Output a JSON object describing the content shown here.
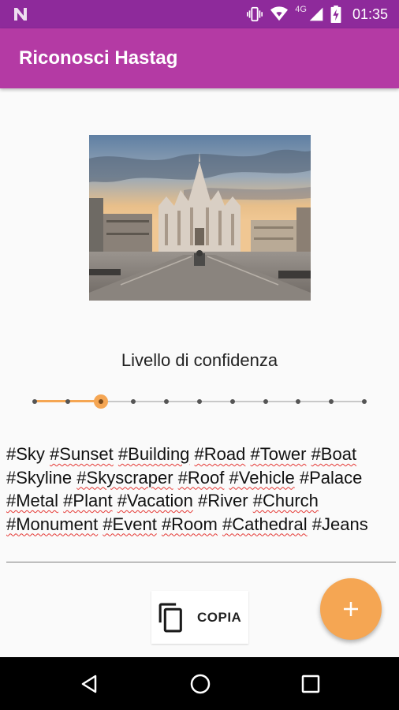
{
  "status_bar": {
    "time": "01:35",
    "network": "4G",
    "icons": [
      "n-notification-icon",
      "vibrate-icon",
      "wifi-icon",
      "signal-icon",
      "battery-charging-icon"
    ]
  },
  "app_bar": {
    "title": "Riconosci Hastag",
    "color": "#b43aa4"
  },
  "image": {
    "icon": "photo-cathedral-image"
  },
  "confidence": {
    "label": "Livello di confidenza",
    "level": 2,
    "steps": 11,
    "accent": "#f5a653"
  },
  "tags": [
    {
      "text": "#Sky",
      "flagged": false
    },
    {
      "text": "#Sunset",
      "flagged": true
    },
    {
      "text": "#Building",
      "flagged": true
    },
    {
      "text": "#Road",
      "flagged": true
    },
    {
      "text": "#Tower",
      "flagged": true
    },
    {
      "text": "#Boat",
      "flagged": true
    },
    {
      "text": "#Skyline",
      "flagged": false
    },
    {
      "text": "#Skyscraper",
      "flagged": true
    },
    {
      "text": "#Roof",
      "flagged": true
    },
    {
      "text": "#Vehicle",
      "flagged": true
    },
    {
      "text": "#Palace",
      "flagged": false
    },
    {
      "text": "#Metal",
      "flagged": true
    },
    {
      "text": "#Plant",
      "flagged": true
    },
    {
      "text": "#Vacation",
      "flagged": true
    },
    {
      "text": "#River",
      "flagged": false
    },
    {
      "text": "#Church",
      "flagged": true
    },
    {
      "text": "#Monument",
      "flagged": true
    },
    {
      "text": "#Event",
      "flagged": true
    },
    {
      "text": "#Room",
      "flagged": true
    },
    {
      "text": "#Cathedral",
      "flagged": true
    },
    {
      "text": "#Jeans",
      "flagged": false
    }
  ],
  "copy_button": {
    "label": "COPIA",
    "icon": "copy-icon"
  },
  "fab": {
    "icon": "plus-icon",
    "color": "#f5a653"
  },
  "nav_bar": {
    "icons": [
      "back-icon",
      "home-icon",
      "recents-icon"
    ]
  }
}
